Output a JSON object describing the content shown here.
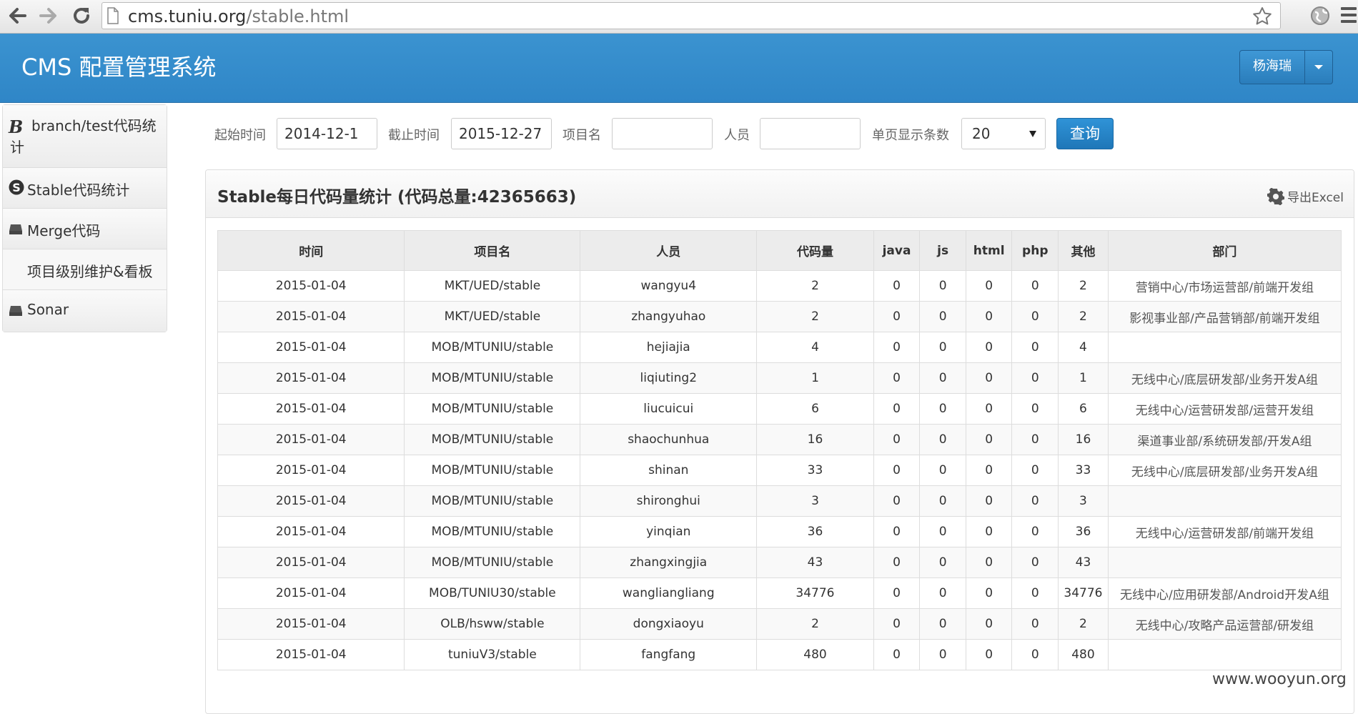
{
  "browser": {
    "url_host": "cms.tuniu.org",
    "url_path": "/stable.html"
  },
  "header": {
    "title": "CMS 配置管理系统",
    "user": "杨海瑞",
    "color": "#3990cd"
  },
  "sidebar": {
    "items": [
      {
        "label": "branch/test代码统计",
        "icon": "bold-b-icon"
      },
      {
        "label": "Stable代码统计",
        "icon": "skype-s-icon"
      },
      {
        "label": "Merge代码",
        "icon": "drive-icon"
      },
      {
        "label": "项目级别维护&看板",
        "icon": ""
      },
      {
        "label": "Sonar",
        "icon": "drive-icon"
      }
    ]
  },
  "filter": {
    "start_label": "起始时间",
    "start_value": "2014-12-1",
    "end_label": "截止时间",
    "end_value": "2015-12-27",
    "project_label": "项目名",
    "project_value": "",
    "person_label": "人员",
    "person_value": "",
    "page_size_label": "单页显示条数",
    "page_size_value": "20",
    "query_label": "查询"
  },
  "panel": {
    "title": "Stable每日代码量统计 (代码总量:42365663)",
    "export_label": "导出Excel"
  },
  "table": {
    "headers": [
      "时间",
      "项目名",
      "人员",
      "代码量",
      "java",
      "js",
      "html",
      "php",
      "其他",
      "部门"
    ],
    "rows": [
      [
        "2015-01-04",
        "MKT/UED/stable",
        "wangyu4",
        "2",
        "0",
        "0",
        "0",
        "0",
        "2",
        "营销中心/市场运营部/前端开发组"
      ],
      [
        "2015-01-04",
        "MKT/UED/stable",
        "zhangyuhao",
        "2",
        "0",
        "0",
        "0",
        "0",
        "2",
        "影视事业部/产品营销部/前端开发组"
      ],
      [
        "2015-01-04",
        "MOB/MTUNIU/stable",
        "hejiajia",
        "4",
        "0",
        "0",
        "0",
        "0",
        "4",
        ""
      ],
      [
        "2015-01-04",
        "MOB/MTUNIU/stable",
        "liqiuting2",
        "1",
        "0",
        "0",
        "0",
        "0",
        "1",
        "无线中心/底层研发部/业务开发A组"
      ],
      [
        "2015-01-04",
        "MOB/MTUNIU/stable",
        "liucuicui",
        "6",
        "0",
        "0",
        "0",
        "0",
        "6",
        "无线中心/运营研发部/运营开发组"
      ],
      [
        "2015-01-04",
        "MOB/MTUNIU/stable",
        "shaochunhua",
        "16",
        "0",
        "0",
        "0",
        "0",
        "16",
        "渠道事业部/系统研发部/开发A组"
      ],
      [
        "2015-01-04",
        "MOB/MTUNIU/stable",
        "shinan",
        "33",
        "0",
        "0",
        "0",
        "0",
        "33",
        "无线中心/底层研发部/业务开发A组"
      ],
      [
        "2015-01-04",
        "MOB/MTUNIU/stable",
        "shironghui",
        "3",
        "0",
        "0",
        "0",
        "0",
        "3",
        ""
      ],
      [
        "2015-01-04",
        "MOB/MTUNIU/stable",
        "yinqian",
        "36",
        "0",
        "0",
        "0",
        "0",
        "36",
        "无线中心/运营研发部/前端开发组"
      ],
      [
        "2015-01-04",
        "MOB/MTUNIU/stable",
        "zhangxingjia",
        "43",
        "0",
        "0",
        "0",
        "0",
        "43",
        ""
      ],
      [
        "2015-01-04",
        "MOB/TUNIU30/stable",
        "wangliangliang",
        "34776",
        "0",
        "0",
        "0",
        "0",
        "34776",
        "无线中心/应用研发部/Android开发A组"
      ],
      [
        "2015-01-04",
        "OLB/hsww/stable",
        "dongxiaoyu",
        "2",
        "0",
        "0",
        "0",
        "0",
        "2",
        "无线中心/攻略产品运营部/研发组"
      ],
      [
        "2015-01-04",
        "tuniuV3/stable",
        "fangfang",
        "480",
        "0",
        "0",
        "0",
        "0",
        "480",
        ""
      ]
    ]
  },
  "watermark": "www.wooyun.org"
}
